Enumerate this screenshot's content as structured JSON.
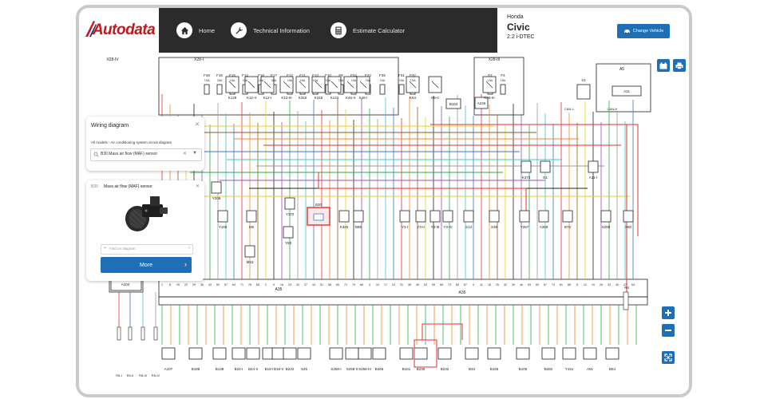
{
  "brand": {
    "name": "Autodata",
    "red": "#c4161c",
    "blue": "#1f6fb7",
    "dark": "#2b2b2b"
  },
  "nav": [
    {
      "label": "Home",
      "icon": "home-icon"
    },
    {
      "label": "Technical Information",
      "icon": "wrench-icon"
    },
    {
      "label": "Estimate Calculator",
      "icon": "calculator-icon"
    }
  ],
  "vehicle": {
    "make": "Honda",
    "model": "Civic",
    "engine": "2.2 i-DTEC",
    "change_label": "Change Vehicle"
  },
  "wiring_panel": {
    "title": "Wiring diagram",
    "subtitle": "All models - Air conditioning system circuit diagram",
    "selected": "B30 Mass air flow (MAF) sensor"
  },
  "component_panel": {
    "code": "B30",
    "name": "Mass air flow (MAF) sensor",
    "find_placeholder": "Find on diagram",
    "more_label": "More"
  },
  "labels": {
    "connectors_top": [
      "X28-IV",
      "X28-I",
      "X28-II",
      "X28-III"
    ],
    "fuses": [
      "F48",
      "F16",
      "F15",
      "F14",
      "F18",
      "F17",
      "F12",
      "F11",
      "F13",
      "F10",
      "F9",
      "F34",
      "F22",
      "F35",
      "F31",
      "F32",
      "F2",
      "F4"
    ],
    "fuse_ratings": [
      "7.5A",
      "20A",
      "10A",
      "10A",
      "15A",
      "30A",
      "15A",
      "15A",
      "10A",
      "10A",
      "15A",
      "10A",
      "15A",
      "10A",
      "10A",
      "7.5A",
      "10A",
      "15A"
    ],
    "relays": [
      "K129",
      "K12-II",
      "K12-I",
      "K12-III",
      "K310",
      "K318",
      "K143",
      "K46-II",
      "K46-I",
      "K84",
      "K6-II",
      "K46-III"
    ],
    "modules_top": [
      "B153",
      "A246",
      "A5",
      "A11",
      "X1"
    ],
    "mid_components": [
      "Y208",
      "Y165",
      "M6",
      "M63",
      "Y170",
      "Y63",
      "B30",
      "K325",
      "B86",
      "Y3-I",
      "Y3-II",
      "Y3-III",
      "Y3-IV",
      "S13",
      "S39",
      "Y267",
      "A369",
      "B72",
      "S259",
      "X80",
      "K373",
      "G1",
      "A11-I"
    ],
    "left_components": [
      "A104",
      "R5-I",
      "R5-II",
      "R5-III",
      "R5-IV"
    ],
    "ecu_names": [
      "A35",
      "A35"
    ],
    "bottom_components": [
      "A107",
      "B188",
      "B138",
      "B24-I",
      "B24-II",
      "B18-I",
      "B18-II",
      "B222",
      "S25",
      "S258-I",
      "S258-II",
      "S258-III",
      "B465",
      "B161",
      "B239",
      "B232",
      "B33",
      "B155",
      "B105",
      "B282",
      "Y151",
      "A91",
      "B54"
    ],
    "right_components": [
      "R4"
    ],
    "can": [
      "CAN-L",
      "CAN-H"
    ]
  },
  "colors": {
    "wire_red": "#e0312f",
    "wire_yellow": "#e8d21a",
    "wire_green": "#2aa84a",
    "wire_blue": "#3b74d1",
    "wire_brown": "#8b5a2b",
    "wire_purple": "#9a4fc4",
    "wire_cyan": "#46c4d6",
    "wire_orange": "#f08a24",
    "wire_black": "#222222",
    "wire_grey": "#9a9a9a",
    "highlight": "#e0312f"
  }
}
